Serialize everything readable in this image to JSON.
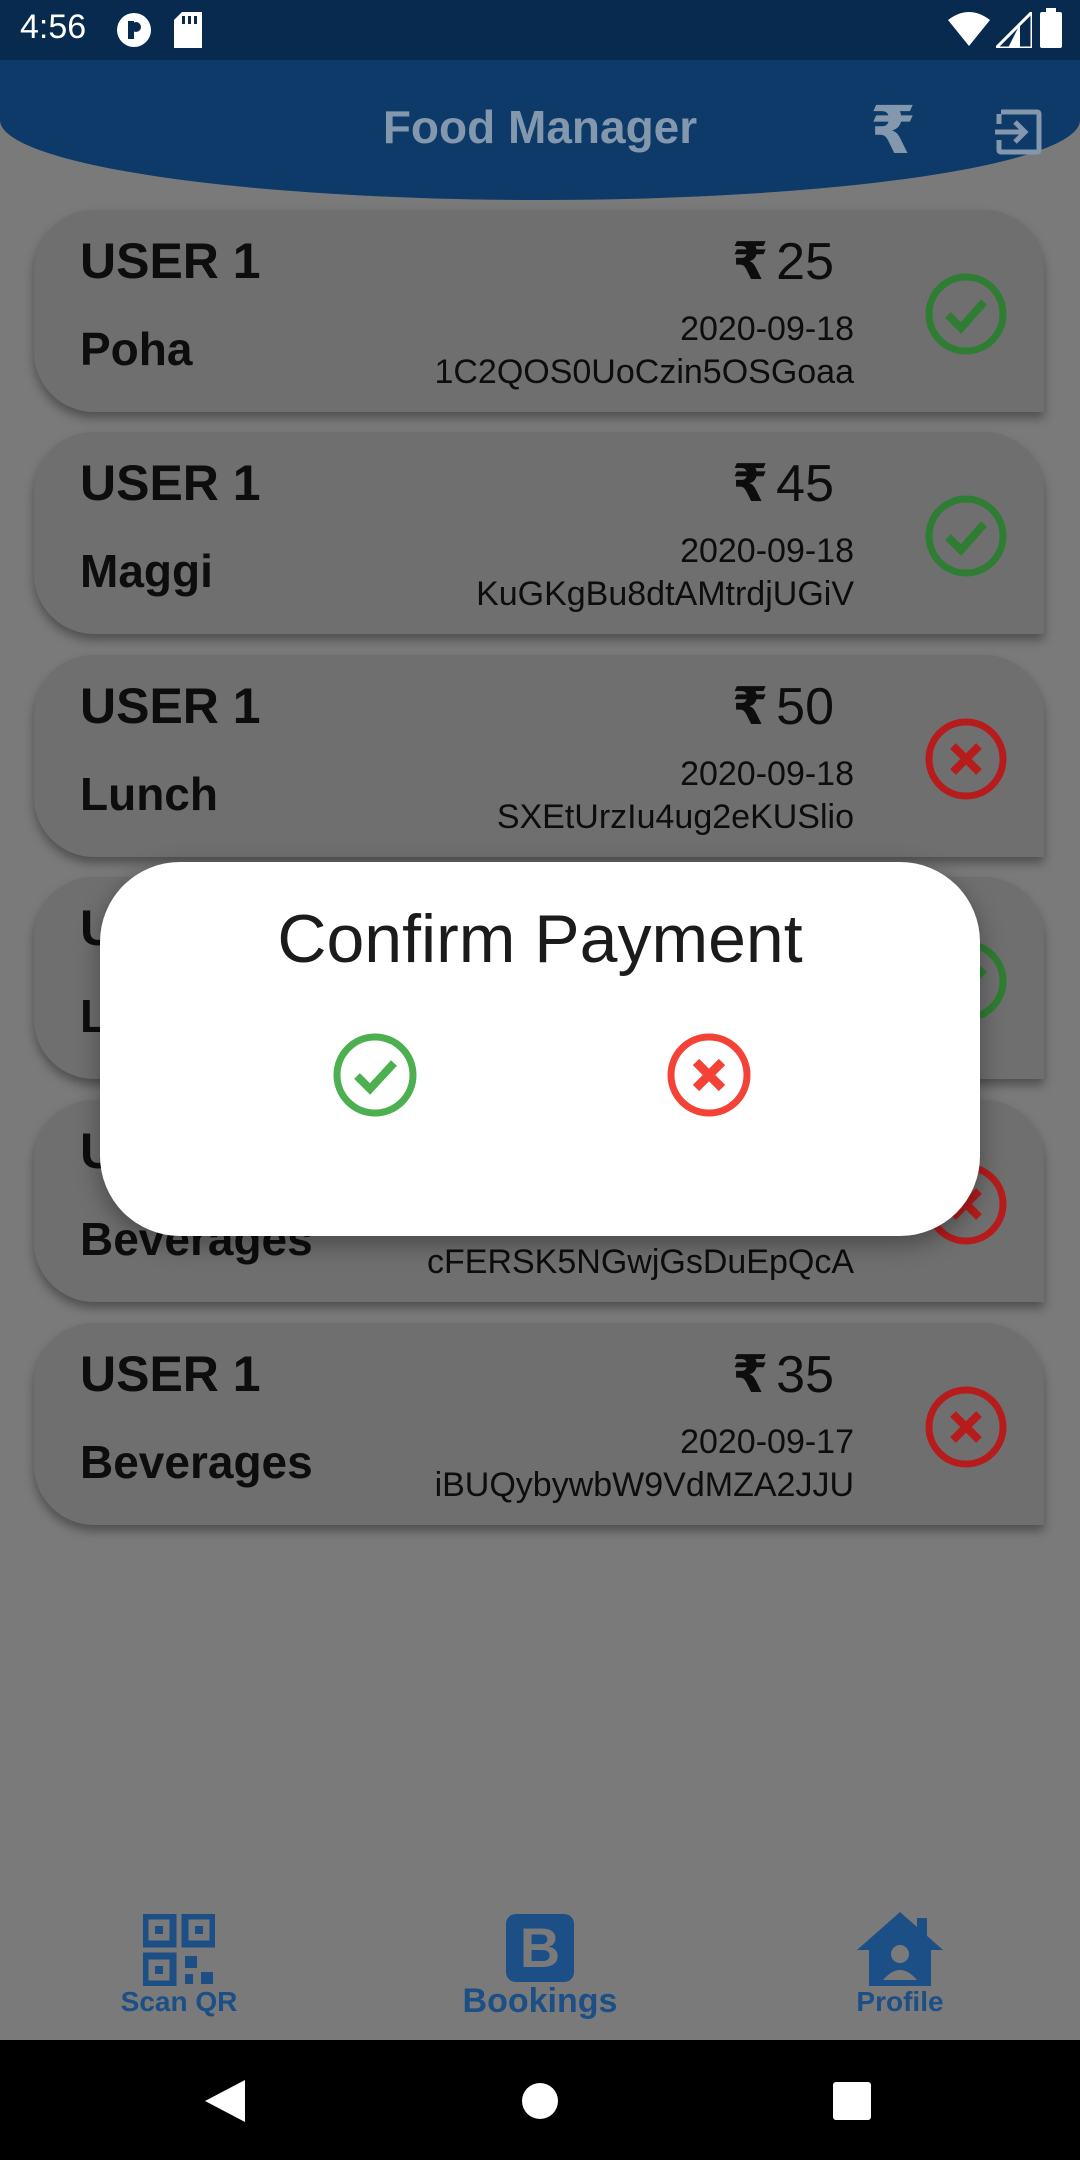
{
  "status_bar": {
    "time": "4:56"
  },
  "header": {
    "title": "Food Manager",
    "rupee_icon": "rupee-icon",
    "logout_icon": "logout-icon",
    "currency_symbol": "₹"
  },
  "orders": [
    {
      "user": "USER 1",
      "item": "Poha",
      "price": "25",
      "date": "2020-09-18",
      "id": "1C2QOS0UoCzin5OSGoaa",
      "status": "check"
    },
    {
      "user": "USER 1",
      "item": "Maggi",
      "price": "45",
      "date": "2020-09-18",
      "id": "KuGKgBu8dtAMtrdjUGiV",
      "status": "check"
    },
    {
      "user": "USER 1",
      "item": "Lunch",
      "price": "50",
      "date": "2020-09-18",
      "id": "SXEtUrzIu4ug2eKUSlio",
      "status": "cross"
    },
    {
      "user": "U",
      "item": "L",
      "price": "",
      "date": "",
      "id": "",
      "status": "check"
    },
    {
      "user": "U",
      "item": "Beverages",
      "price": "",
      "date": "",
      "id": "cFERSK5NGwjGsDuEpQcA",
      "status": "cross"
    },
    {
      "user": "USER 1",
      "item": "Beverages",
      "price": "35",
      "date": "2020-09-17",
      "id": "iBUQybywbW9VdMZA2JJU",
      "status": "cross"
    }
  ],
  "dialog": {
    "title": "Confirm Payment",
    "confirm_icon": "check-circle-icon",
    "cancel_icon": "close-circle-icon"
  },
  "bottom_nav": {
    "scan_qr": "Scan QR",
    "bookings": "Bookings",
    "profile": "Profile",
    "bookings_badge": "B"
  },
  "colors": {
    "check": "#2e7d32",
    "cross": "#b71c1c",
    "dialog_check": "#4caf50",
    "dialog_cross": "#f44336",
    "nav": "#1b4f86"
  }
}
